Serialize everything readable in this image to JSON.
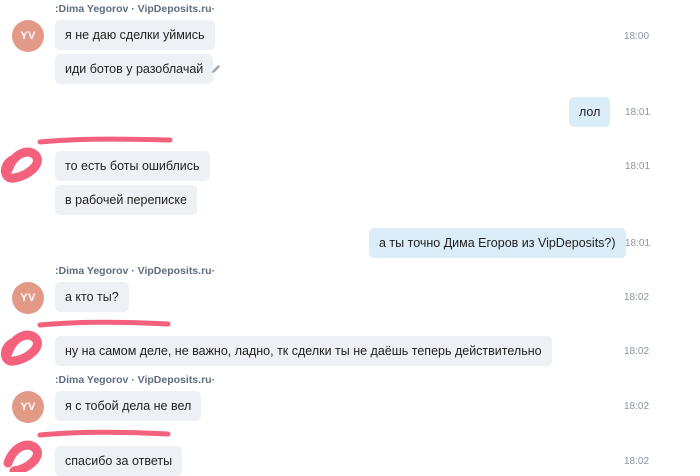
{
  "colors": {
    "avatar_bg": "#e29a87",
    "incoming_bubble": "#edf0f5",
    "outgoing_bubble": "#dbedf8",
    "redaction": "#f2506e"
  },
  "messages": [
    {
      "sender": ":Dima Yegorov · VipDeposits.ru·",
      "avatar": "YV",
      "text": "я не даю сделки уймись",
      "time": "18:00"
    },
    {
      "text": "иди ботов у разоблачай",
      "icon": "edit-pencil-icon"
    },
    {
      "text": "лол",
      "time": "18:01"
    },
    {
      "text": "то есть боты ошиблись",
      "time": "18:01"
    },
    {
      "text": "в рабочей переписке"
    },
    {
      "text": "а ты точно Дима Егоров из VipDeposits?)",
      "time": "18:01"
    },
    {
      "sender": ":Dima Yegorov · VipDeposits.ru·",
      "avatar": "YV",
      "text": "а кто ты?",
      "time": "18:02"
    },
    {
      "text": "ну на самом деле, не важно, ладно, тк сделки ты не даёшь теперь действительно",
      "time": "18:02"
    },
    {
      "sender": ":Dima Yegorov · VipDeposits.ru·",
      "avatar": "YV",
      "text": "я с тобой дела не вел",
      "time": "18:02"
    },
    {
      "text": "спасибо за ответы",
      "time": "18:02"
    }
  ]
}
